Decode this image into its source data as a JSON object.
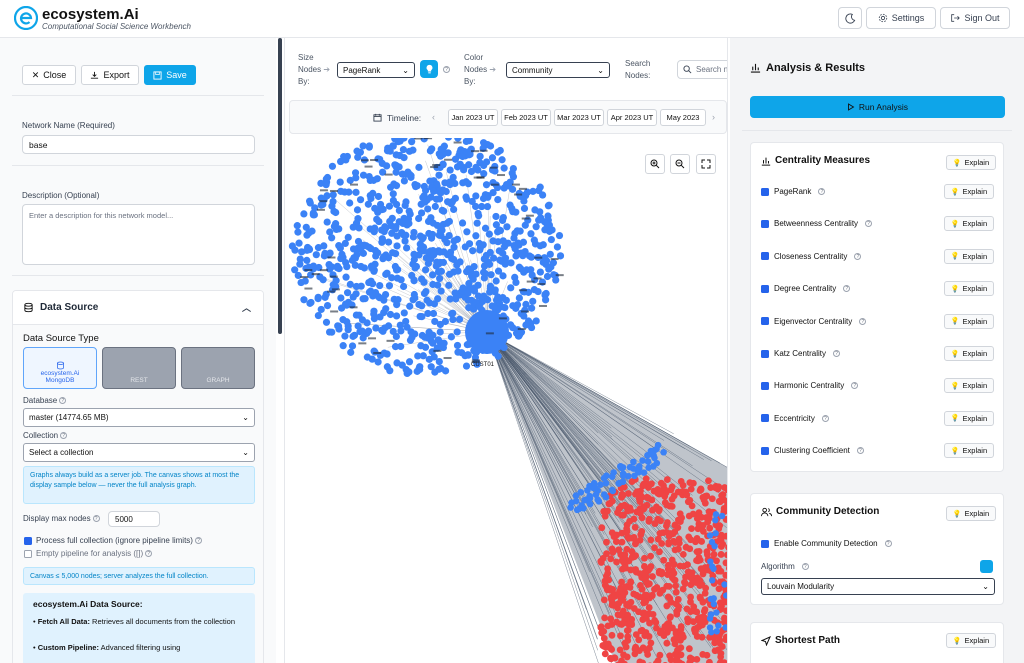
{
  "header": {
    "brand": "ecosystem.Ai",
    "tagline": "Computational Social Science Workbench",
    "settings_label": "Settings",
    "signout_label": "Sign Out"
  },
  "left": {
    "close_label": "Close",
    "export_label": "Export",
    "save_label": "Save",
    "network_name_label": "Network Name (Required)",
    "network_name_value": "base",
    "description_label": "Description (Optional)",
    "description_placeholder": "Enter a description for this network model...",
    "data_source_title": "Data Source",
    "data_source_type_label": "Data Source Type",
    "tiles": [
      {
        "line1": "ecosystem.Ai",
        "line2": "MongoDB"
      },
      {
        "line1": "",
        "line2": "REST"
      },
      {
        "line1": "",
        "line2": "GRAPH"
      }
    ],
    "database_label": "Database",
    "database_value": "master (14774.65 MB)",
    "collection_label": "Collection",
    "collection_value": "Select a collection",
    "info1": "Graphs always build as a server job. The canvas shows at most the display sample below — never the full analysis graph.",
    "display_max_label": "Display max nodes",
    "display_max_value": "5000",
    "process_full_label": "Process full collection (ignore pipeline limits)",
    "empty_pipeline_label": "Empty pipeline for analysis ([])",
    "info2": "Canvas ≤ 5,000 nodes; server analyzes the full collection.",
    "eco_title": "ecosystem.Ai Data Source:",
    "eco_items": [
      {
        "bold": "Fetch All Data:",
        "text": " Retrieves all documents from the collection"
      },
      {
        "bold": "Custom Pipeline:",
        "text": " Advanced filtering using"
      }
    ]
  },
  "center": {
    "size_nodes_label_1": "Size",
    "size_nodes_label_2": "Nodes",
    "size_nodes_label_3": "By:",
    "size_value": "PageRank",
    "color_label_1": "Color",
    "color_label_2": "Nodes",
    "color_label_3": "By:",
    "color_value": "Community",
    "search_label_1": "Search",
    "search_label_2": "Nodes:",
    "search_placeholder": "Search n",
    "timeline_label": "Timeline:",
    "dates": [
      "Jan 2023 UT",
      "Feb 2023 UT",
      "Mar 2023 UT",
      "Apr 2023 UT",
      "May 2023"
    ],
    "hub_label": "CUST01",
    "colors": {
      "blue": "#3b82f6",
      "red": "#ef4444",
      "edge": "#475569"
    }
  },
  "right": {
    "title": "Analysis & Results",
    "run_label": "Run Analysis",
    "centrality_title": "Centrality Measures",
    "explain_label": "Explain",
    "measures": [
      "PageRank",
      "Betweenness Centrality",
      "Closeness Centrality",
      "Degree Centrality",
      "Eigenvector Centrality",
      "Katz Centrality",
      "Harmonic Centrality",
      "Eccentricity",
      "Clustering Coefficient"
    ],
    "community_title": "Community Detection",
    "enable_community_label": "Enable Community Detection",
    "algorithm_label": "Algorithm",
    "algorithm_value": "Louvain Modularity",
    "shortest_title": "Shortest Path"
  }
}
